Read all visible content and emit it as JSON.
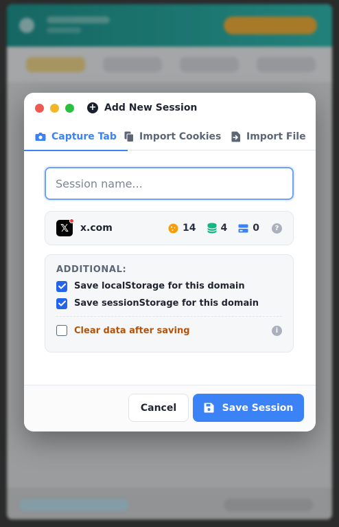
{
  "modal": {
    "title": "Add New Session",
    "tabs": [
      {
        "label": "Capture Tab",
        "active": true
      },
      {
        "label": "Import Cookies",
        "active": false
      },
      {
        "label": "Import File",
        "active": false
      }
    ],
    "session_name": {
      "value": "",
      "placeholder": "Session name..."
    },
    "domain": {
      "name": "x.com",
      "cookies_count": "14",
      "local_storage_count": "4",
      "session_storage_count": "0"
    },
    "additional": {
      "title": "ADDITIONAL:",
      "options": [
        {
          "label": "Save localStorage for this domain",
          "checked": true
        },
        {
          "label": "Save sessionStorage for this domain",
          "checked": true
        }
      ],
      "clear_label": "Clear data after saving",
      "clear_checked": false
    },
    "buttons": {
      "cancel": "Cancel",
      "save": "Save Session"
    }
  },
  "colors": {
    "accent": "#3b82f6",
    "warning_text": "#b45309",
    "cookie_icon": "#f59e0b",
    "storage_icon": "#10b981",
    "session_icon": "#3b82f6"
  }
}
